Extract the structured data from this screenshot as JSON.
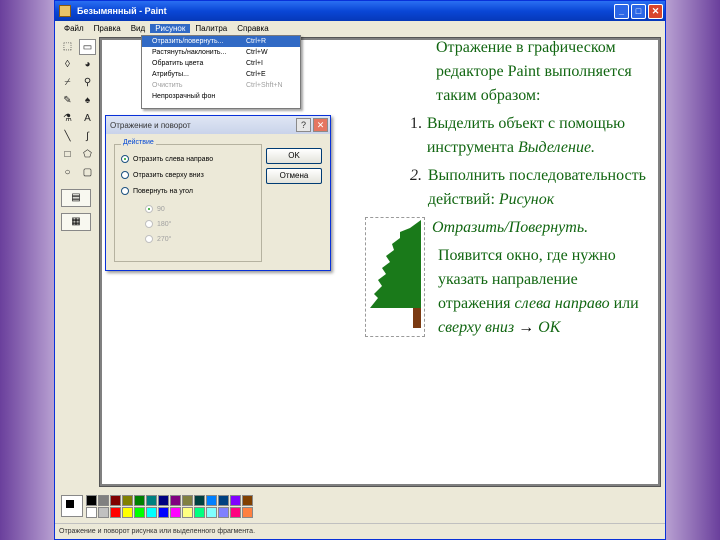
{
  "window": {
    "title": "Безымянный - Paint",
    "controls": {
      "minimize": "_",
      "maximize": "□",
      "close": "✕"
    }
  },
  "menubar": [
    {
      "label": "Файл"
    },
    {
      "label": "Правка"
    },
    {
      "label": "Вид"
    },
    {
      "label": "Рисунок",
      "active": true
    },
    {
      "label": "Палитра"
    },
    {
      "label": "Справка"
    }
  ],
  "image_menu": {
    "items": [
      {
        "label": "Отразить/повернуть...",
        "shortcut": "Ctrl+R",
        "highlighted": true
      },
      {
        "label": "Растянуть/наклонить...",
        "shortcut": "Ctrl+W"
      },
      {
        "label": "Обратить цвета",
        "shortcut": "Ctrl+I"
      },
      {
        "label": "Атрибуты...",
        "shortcut": "Ctrl+E"
      },
      {
        "label": "Очистить",
        "shortcut": "Ctrl+Shft+N",
        "disabled": true
      },
      {
        "label": "Непрозрачный фон",
        "shortcut": ""
      }
    ]
  },
  "dialog": {
    "title": "Отражение и поворот",
    "help": "?",
    "close": "✕",
    "group_label": "Действие",
    "options": [
      {
        "label": "Отразить слева направо",
        "checked": true
      },
      {
        "label": "Отразить сверху вниз",
        "checked": false
      },
      {
        "label": "Повернуть на угол",
        "checked": false
      }
    ],
    "angles": [
      "90",
      "180°",
      "270°"
    ],
    "ok": "OK",
    "cancel": "Отмена"
  },
  "statusbar": {
    "text": "Отражение и поворот рисунка или выделенного фрагмента."
  },
  "palette_colors": [
    "#000000",
    "#808080",
    "#800000",
    "#808000",
    "#008000",
    "#008080",
    "#000080",
    "#800080",
    "#808040",
    "#004040",
    "#0080ff",
    "#004080",
    "#8000ff",
    "#804000",
    "#ffffff",
    "#c0c0c0",
    "#ff0000",
    "#ffff00",
    "#00ff00",
    "#00ffff",
    "#0000ff",
    "#ff00ff",
    "#ffff80",
    "#00ff80",
    "#80ffff",
    "#8080ff",
    "#ff0080",
    "#ff8040"
  ],
  "slide": {
    "intro": "Отражение в графическом редакторе Paint выполняется таким образом:",
    "step1_num": "1.",
    "step1_text": "Выделить объект с помощью инструмента",
    "step1_tool": "Выделение.",
    "step2_num": "2.",
    "step2_text": "Выполнить последовательность действий:",
    "step2_path_a": "Рисунок",
    "step2_path_b": "Отразить/Повернуть.",
    "result_text": "Появится окно, где нужно указать направление отражения",
    "dir1": "слева направо",
    "or": "или",
    "dir2": "сверху вниз",
    "arrow": "→",
    "ok": "OK"
  }
}
